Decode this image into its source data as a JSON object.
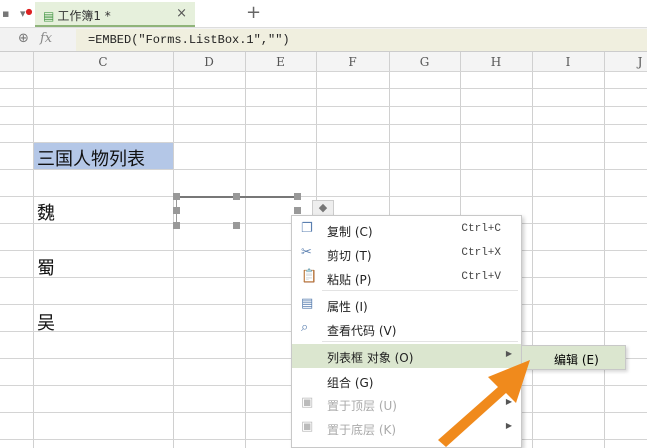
{
  "tabbar": {
    "tab_title": "工作簿1 *",
    "close": "×",
    "new_tab": "+"
  },
  "formula_bar": {
    "fx": "fx",
    "zoom_icon": "zoom-icon",
    "formula": "=EMBED(\"Forms.ListBox.1\",\"\")"
  },
  "columns": [
    "C",
    "D",
    "E",
    "F",
    "G",
    "H",
    "I",
    "J"
  ],
  "cells": {
    "title": "三国人物列表",
    "wei": "魏",
    "shu": "蜀",
    "wu": "吴"
  },
  "context_menu": {
    "items": [
      {
        "label": "复制 (C)",
        "shortcut": "Ctrl+C",
        "icon": "copy-icon",
        "glyph": "❐"
      },
      {
        "label": "剪切 (T)",
        "shortcut": "Ctrl+X",
        "icon": "scissors-icon",
        "glyph": "✂"
      },
      {
        "label": "粘贴 (P)",
        "shortcut": "Ctrl+V",
        "icon": "paste-icon",
        "glyph": "📋"
      },
      {
        "label": "属性 (I)",
        "icon": "properties-icon",
        "glyph": "▤"
      },
      {
        "label": "查看代码 (V)",
        "icon": "view-code-icon",
        "glyph": "⌕"
      },
      {
        "label": "列表框 对象 (O)",
        "icon": "",
        "glyph": "",
        "submenu": true
      },
      {
        "label": "组合 (G)",
        "icon": "",
        "glyph": ""
      },
      {
        "label": "置于顶层 (U)",
        "icon": "bring-front-icon",
        "glyph": "▣",
        "disabled": true,
        "submenu": true
      },
      {
        "label": "置于底层 (K)",
        "icon": "send-back-icon",
        "glyph": "▣",
        "disabled": true,
        "submenu": true
      }
    ],
    "submenu": {
      "label": "编辑 (E)"
    }
  },
  "colors": {
    "accent": "#dbe6cf",
    "highlight": "#b4c7e7",
    "arrow": "#f08a1c"
  }
}
